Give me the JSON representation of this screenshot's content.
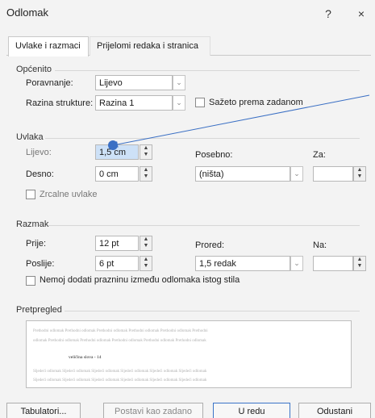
{
  "window": {
    "title": "Odlomak",
    "help_label": "?",
    "close_label": "×"
  },
  "tabs": [
    {
      "label": "Uvlake i razmaci"
    },
    {
      "label": "Prijelomi redaka i stranica"
    }
  ],
  "general": {
    "heading": "Općenito",
    "alignment_label": "Poravnanje:",
    "alignment_value": "Lijevo",
    "outline_label": "Razina strukture:",
    "outline_value": "Razina 1",
    "collapsed_label": "Sažeto prema zadanom"
  },
  "indent": {
    "heading": "Uvlaka",
    "left_label": "Lijevo:",
    "left_value": "1,5 cm",
    "right_label": "Desno:",
    "right_value": "0 cm",
    "special_label": "Posebno:",
    "special_value": "(ništa)",
    "by_label": "Za:",
    "by_value": "",
    "mirror_label": "Zrcalne uvlake"
  },
  "spacing": {
    "heading": "Razmak",
    "before_label": "Prije:",
    "before_value": "12 pt",
    "after_label": "Poslije:",
    "after_value": "6 pt",
    "line_label": "Prored:",
    "line_value": "1,5 redak",
    "at_label": "Na:",
    "at_value": "",
    "no_space_label": "Nemoj dodati prazninu između odlomaka istog stila"
  },
  "preview": {
    "heading": "Pretpregled",
    "prev_line_1": "Prethodni odlomak Prethodni odlomak Prethodni odlomak Prethodni odlomak Prethodni odlomak Prethodni",
    "prev_line_2": "odlomak Prethodni odlomak Prethodni odlomak Prethodni odlomak Prethodni odlomak Prethodni odlomak",
    "sample_text": "veličina slova - 14",
    "next_line_1": "Sljedeći odlomak Sljedeći odlomak Sljedeći odlomak Sljedeći odlomak Sljedeći odlomak Sljedeći odlomak",
    "next_line_2": "Sljedeći odlomak Sljedeći odlomak Sljedeći odlomak Sljedeći odlomak Sljedeći odlomak Sljedeći odlomak"
  },
  "buttons": {
    "tabs": "Tabulatori...",
    "default": "Postavi kao zadano",
    "ok": "U redu",
    "cancel": "Odustani"
  },
  "colors": {
    "annotation_arrow": "#3a6fc4",
    "selection": "#cde1f7"
  }
}
